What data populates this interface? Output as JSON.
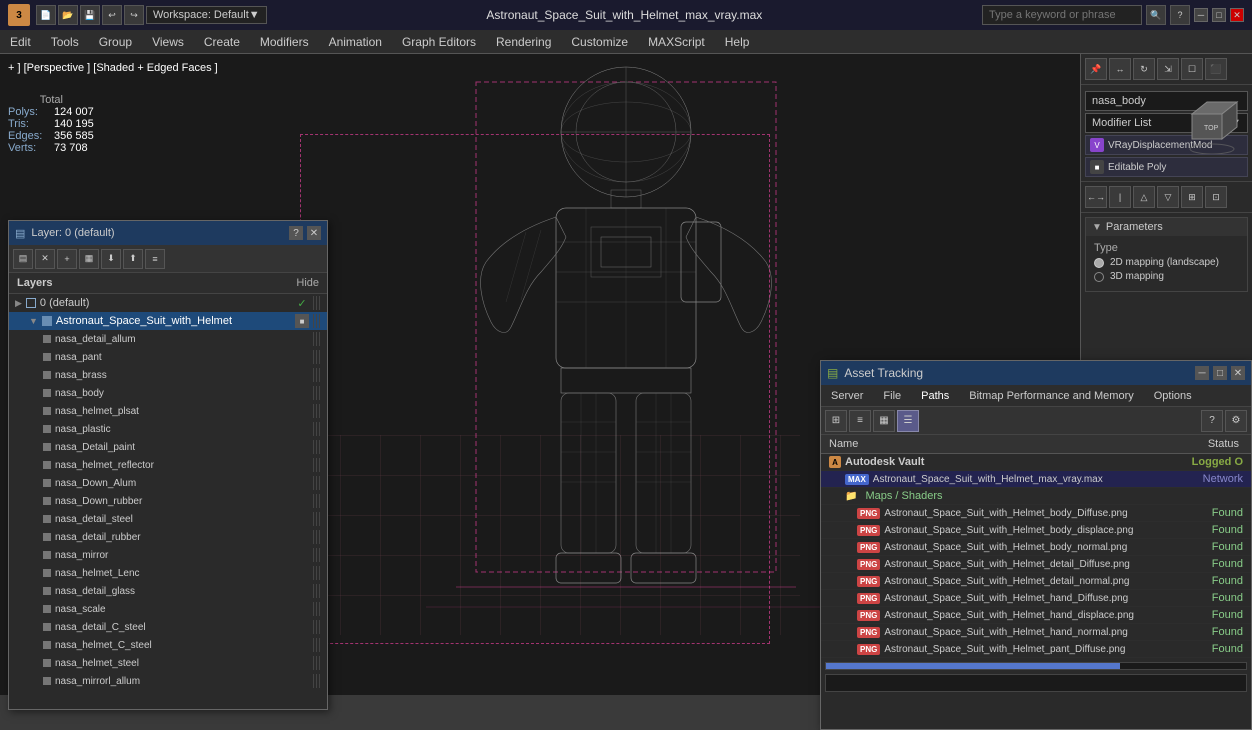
{
  "titlebar": {
    "logo": "3",
    "title": "Astronaut_Space_Suit_with_Helmet_max_vray.max",
    "workspace_label": "Workspace: Default",
    "search_placeholder": "Type a keyword or phrase"
  },
  "menubar": {
    "items": [
      "Edit",
      "Tools",
      "Group",
      "Views",
      "Create",
      "Modifiers",
      "Animation",
      "Graph Editors",
      "Rendering",
      "Customize",
      "MAXScript",
      "Help"
    ]
  },
  "viewport": {
    "label": "+ ] [Perspective ] [Shaded + Edged Faces ]",
    "stats": {
      "polys_label": "Polys:",
      "polys_val": "124 007",
      "tris_label": "Tris:",
      "tris_val": "140 195",
      "edges_label": "Edges:",
      "edges_val": "356 585",
      "verts_label": "Verts:",
      "verts_val": "73 708",
      "total_label": "Total"
    }
  },
  "right_panel": {
    "name": "nasa_body",
    "modifier_list_label": "Modifier List",
    "modifiers": [
      {
        "name": "VRayDisplacementMod",
        "type": "vray"
      },
      {
        "name": "Editable Poly",
        "type": "poly"
      }
    ],
    "parameters_label": "Parameters",
    "type_label": "Type",
    "type_options": [
      {
        "label": "2D mapping (landscape)",
        "selected": true
      },
      {
        "label": "3D mapping",
        "selected": false
      }
    ]
  },
  "layers_panel": {
    "title": "Layer: 0 (default)",
    "hide_label": "Hide",
    "layers_label": "Layers",
    "items": [
      {
        "name": "0 (default)",
        "level": 0,
        "checked": true,
        "type": "layer"
      },
      {
        "name": "Astronaut_Space_Suit_with_Helmet",
        "level": 1,
        "selected": true,
        "type": "group"
      },
      {
        "name": "nasa_detail_allum",
        "level": 2,
        "type": "mesh"
      },
      {
        "name": "nasa_pant",
        "level": 2,
        "type": "mesh"
      },
      {
        "name": "nasa_brass",
        "level": 2,
        "type": "mesh"
      },
      {
        "name": "nasa_body",
        "level": 2,
        "type": "mesh"
      },
      {
        "name": "nasa_helmet_plsat",
        "level": 2,
        "type": "mesh"
      },
      {
        "name": "nasa_plastic",
        "level": 2,
        "type": "mesh"
      },
      {
        "name": "nasa_Detail_paint",
        "level": 2,
        "type": "mesh"
      },
      {
        "name": "nasa_helmet_reflector",
        "level": 2,
        "type": "mesh"
      },
      {
        "name": "nasa_Down_Alum",
        "level": 2,
        "type": "mesh"
      },
      {
        "name": "nasa_Down_rubber",
        "level": 2,
        "type": "mesh"
      },
      {
        "name": "nasa_detail_steel",
        "level": 2,
        "type": "mesh"
      },
      {
        "name": "nasa_detail_rubber",
        "level": 2,
        "type": "mesh"
      },
      {
        "name": "nasa_mirror",
        "level": 2,
        "type": "mesh"
      },
      {
        "name": "nasa_helmet_Lenc",
        "level": 2,
        "type": "mesh"
      },
      {
        "name": "nasa_detail_glass",
        "level": 2,
        "type": "mesh"
      },
      {
        "name": "nasa_scale",
        "level": 2,
        "type": "mesh"
      },
      {
        "name": "nasa_detail_C_steel",
        "level": 2,
        "type": "mesh"
      },
      {
        "name": "nasa_helmet_C_steel",
        "level": 2,
        "type": "mesh"
      },
      {
        "name": "nasa_helmet_steel",
        "level": 2,
        "type": "mesh"
      },
      {
        "name": "nasa_mirrorl_allum",
        "level": 2,
        "type": "mesh"
      }
    ]
  },
  "asset_panel": {
    "title": "Asset Tracking",
    "menu": [
      "Server",
      "File",
      "Paths",
      "Bitmap Performance and Memory",
      "Options"
    ],
    "columns": [
      "Name",
      "Status"
    ],
    "rows": [
      {
        "type": "vault",
        "icon": "vault",
        "name": "Autodesk Vault",
        "status": "Logged O",
        "status_type": "logged"
      },
      {
        "type": "file",
        "icon": "max",
        "name": "Astronaut_Space_Suit_with_Helmet_max_vray.max",
        "status": "Network",
        "status_type": "network"
      },
      {
        "type": "maps",
        "icon": "folder",
        "name": "Maps / Shaders",
        "status": "",
        "status_type": ""
      },
      {
        "type": "texture",
        "icon": "png",
        "name": "Astronaut_Space_Suit_with_Helmet_body_Diffuse.png",
        "status": "Found",
        "status_type": "found"
      },
      {
        "type": "texture",
        "icon": "png",
        "name": "Astronaut_Space_Suit_with_Helmet_body_displace.png",
        "status": "Found",
        "status_type": "found"
      },
      {
        "type": "texture",
        "icon": "png",
        "name": "Astronaut_Space_Suit_with_Helmet_body_normal.png",
        "status": "Found",
        "status_type": "found"
      },
      {
        "type": "texture",
        "icon": "png",
        "name": "Astronaut_Space_Suit_with_Helmet_detail_Diffuse.png",
        "status": "Found",
        "status_type": "found"
      },
      {
        "type": "texture",
        "icon": "png",
        "name": "Astronaut_Space_Suit_with_Helmet_detail_normal.png",
        "status": "Found",
        "status_type": "found"
      },
      {
        "type": "texture",
        "icon": "png",
        "name": "Astronaut_Space_Suit_with_Helmet_hand_Diffuse.png",
        "status": "Found",
        "status_type": "found"
      },
      {
        "type": "texture",
        "icon": "png",
        "name": "Astronaut_Space_Suit_with_Helmet_hand_displace.png",
        "status": "Found",
        "status_type": "found"
      },
      {
        "type": "texture",
        "icon": "png",
        "name": "Astronaut_Space_Suit_with_Helmet_hand_normal.png",
        "status": "Found",
        "status_type": "found"
      },
      {
        "type": "texture",
        "icon": "png",
        "name": "Astronaut_Space_Suit_with_Helmet_pant_Diffuse.png",
        "status": "Found",
        "status_type": "found"
      }
    ],
    "toolbar_icons": [
      "grid-small",
      "grid-medium",
      "grid-large",
      "list-view"
    ],
    "help_icon": "?",
    "settings_icon": "⚙"
  }
}
